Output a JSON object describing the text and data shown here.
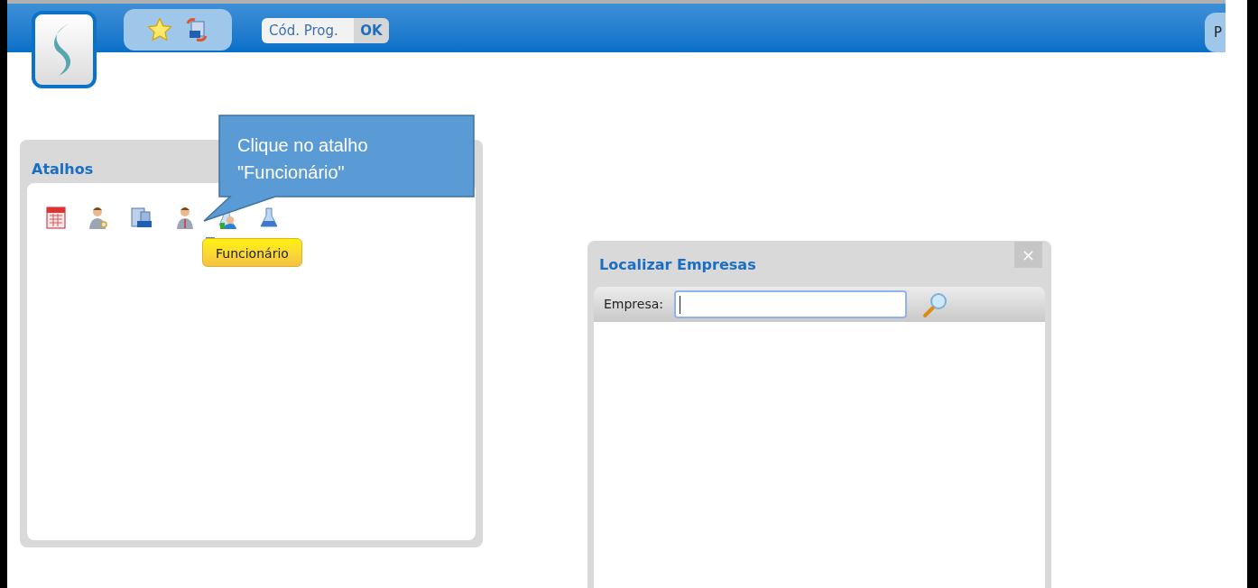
{
  "header": {
    "program_code": {
      "placeholder": "Cód. Prog."
    },
    "ok_button": "OK",
    "cut_button": "P"
  },
  "shortcuts_panel": {
    "title": "Atalhos",
    "tooltip": "Funcionário"
  },
  "callout": {
    "text": "Clique no atalho \"Funcionário\""
  },
  "dialog": {
    "title": "Localizar Empresas",
    "close": "×",
    "field_label": "Empresa:",
    "field_focused": true
  }
}
